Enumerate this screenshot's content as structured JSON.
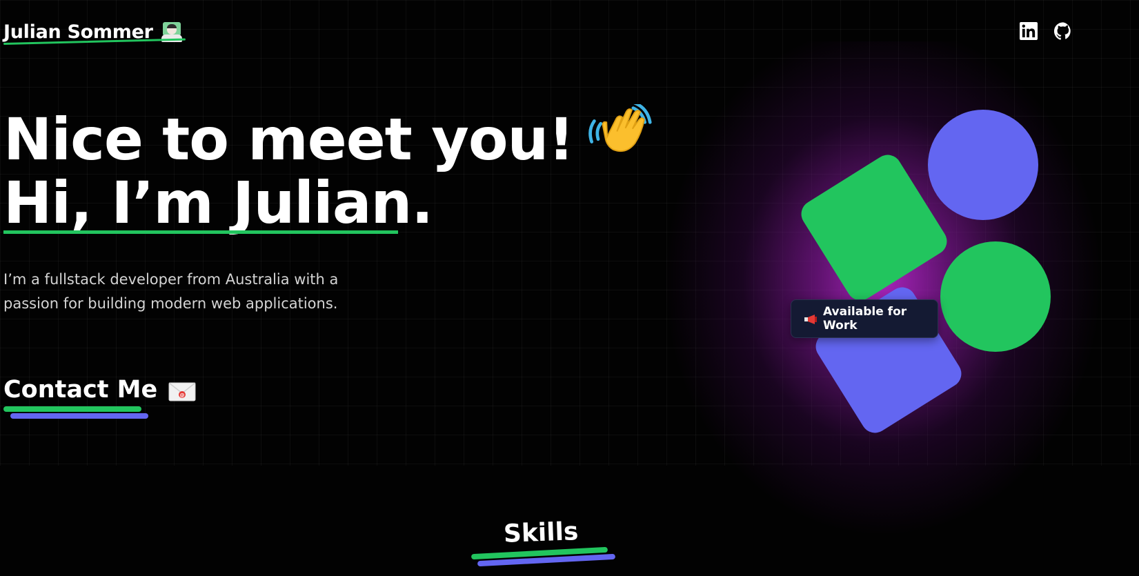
{
  "header": {
    "logo_text": "Julian Sommer",
    "logo_icon": "technologist-emoji",
    "social": [
      {
        "name": "linkedin-icon",
        "label": "LinkedIn"
      },
      {
        "name": "github-icon",
        "label": "GitHub"
      }
    ]
  },
  "hero": {
    "line1": "Nice to meet you!",
    "line1_icon": "waving-hand-emoji",
    "line2": "Hi, I’m Julian.",
    "intro": "I’m a fullstack developer from Australia with a passion for building modern web applications.",
    "contact_label": "Contact Me",
    "contact_icon": "envelope-emoji"
  },
  "badge": {
    "icon": "megaphone-emoji",
    "label": "Available for Work"
  },
  "skills": {
    "title": "Skills"
  },
  "colors": {
    "background": "#020202",
    "accent_green": "#22c55e",
    "accent_purple": "#6366f1",
    "glow": "#b026c4",
    "badge_bg": "#141a33"
  }
}
